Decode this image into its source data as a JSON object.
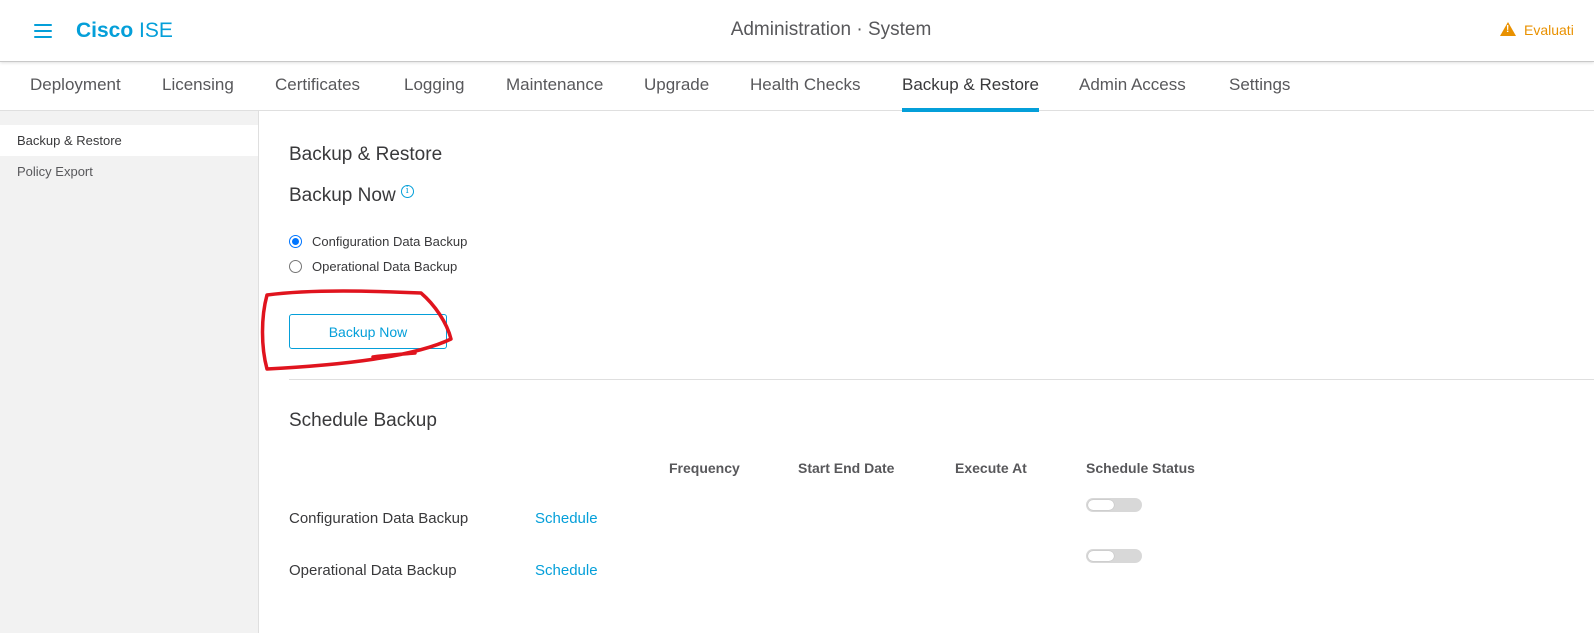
{
  "header": {
    "brand_bold": "Cisco",
    "brand_light": "ISE",
    "page_title": "Administration · System",
    "evaluation_text": "Evaluati",
    "accent_color": "#049fd9",
    "warning_color": "#e99100"
  },
  "tabs": [
    {
      "label": "Deployment"
    },
    {
      "label": "Licensing"
    },
    {
      "label": "Certificates"
    },
    {
      "label": "Logging"
    },
    {
      "label": "Maintenance"
    },
    {
      "label": "Upgrade"
    },
    {
      "label": "Health Checks"
    },
    {
      "label": "Backup & Restore",
      "active": true
    },
    {
      "label": "Admin Access"
    },
    {
      "label": "Settings"
    }
  ],
  "sidebar": {
    "items": [
      {
        "label": "Backup & Restore",
        "active": true
      },
      {
        "label": "Policy Export"
      }
    ]
  },
  "main": {
    "section_title": "Backup & Restore",
    "backup_now_title": "Backup Now",
    "info_glyph": "i",
    "radios": [
      {
        "label": "Configuration Data Backup",
        "checked": true
      },
      {
        "label": "Operational Data Backup",
        "checked": false
      }
    ],
    "backup_button": "Backup Now",
    "annotation_color": "#e0141e",
    "schedule_title": "Schedule Backup",
    "columns": [
      "Frequency",
      "Start End Date",
      "Execute At",
      "Schedule Status"
    ],
    "rows": [
      {
        "label": "Configuration Data Backup",
        "action": "Schedule",
        "enabled": false
      },
      {
        "label": "Operational Data Backup",
        "action": "Schedule",
        "enabled": false
      }
    ]
  }
}
